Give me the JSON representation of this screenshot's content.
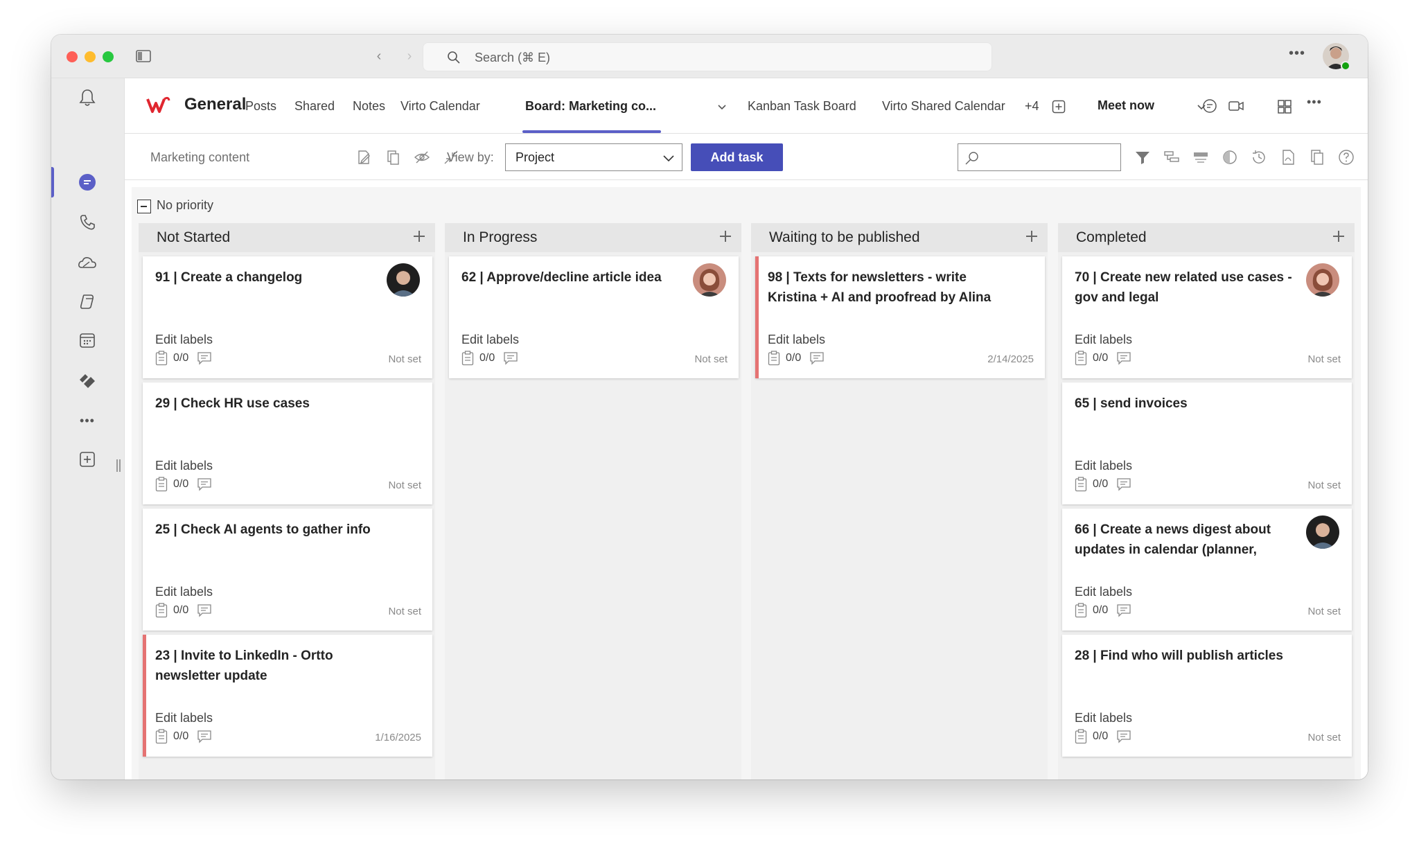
{
  "search": {
    "placeholder": "Search (⌘ E)"
  },
  "header": {
    "channel_name": "General",
    "tabs": [
      {
        "label": "Posts"
      },
      {
        "label": "Shared"
      },
      {
        "label": "Notes"
      },
      {
        "label": "Virto Calendar"
      },
      {
        "label": "Board: Marketing co..."
      },
      {
        "label": "Kanban Task Board"
      },
      {
        "label": "Virto Shared Calendar"
      },
      {
        "label": "+4"
      }
    ],
    "meet_now": "Meet now"
  },
  "toolbar": {
    "board_name": "Marketing content",
    "view_by_label": "View by:",
    "view_by_value": "Project",
    "add_task": "Add task"
  },
  "board": {
    "group_name": "No priority",
    "columns": [
      {
        "title": "Not Started",
        "cards": [
          {
            "title": "91 | Create a changelog",
            "labels": "Edit labels",
            "checklist": "0/0",
            "date": "Not set",
            "avatar": "man-avatar"
          },
          {
            "title": "29 | Check HR use cases",
            "labels": "Edit labels",
            "checklist": "0/0",
            "date": "Not set"
          },
          {
            "title": "25 | Check AI agents to gather info",
            "labels": "Edit labels",
            "checklist": "0/0",
            "date": "Not set"
          },
          {
            "title": "23 | Invite to LinkedIn - Ortto newsletter update",
            "labels": "Edit labels",
            "checklist": "0/0",
            "date": "1/16/2025",
            "flag": true
          }
        ]
      },
      {
        "title": "In Progress",
        "cards": [
          {
            "title": "62 | Approve/decline article idea",
            "labels": "Edit labels",
            "checklist": "0/0",
            "date": "Not set",
            "avatar": "woman-avatar"
          }
        ]
      },
      {
        "title": "Waiting to be published",
        "cards": [
          {
            "title": "98 | Texts for newsletters - write Kristina + AI and proofread by Alina",
            "labels": "Edit labels",
            "checklist": "0/0",
            "date": "2/14/2025",
            "flag": true
          }
        ]
      },
      {
        "title": "Completed",
        "cards": [
          {
            "title": "70 | Create new related use cases - gov and legal",
            "labels": "Edit labels",
            "checklist": "0/0",
            "date": "Not set",
            "avatar": "woman-avatar"
          },
          {
            "title": "65 | send invoices",
            "labels": "Edit labels",
            "checklist": "0/0",
            "date": "Not set"
          },
          {
            "title": "66 | Create a news digest about updates in calendar (planner,",
            "labels": "Edit labels",
            "checklist": "0/0",
            "date": "Not set",
            "avatar": "man-avatar"
          },
          {
            "title": "28 | Find who will publish articles",
            "labels": "Edit labels",
            "checklist": "0/0",
            "date": "Not set"
          }
        ]
      }
    ]
  },
  "colors": {
    "accent": "#5b5fc7",
    "button": "#464eb8",
    "flag": "#e57373"
  }
}
